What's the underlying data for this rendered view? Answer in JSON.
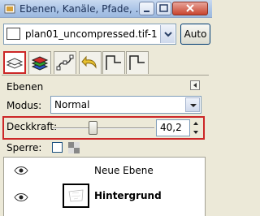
{
  "window": {
    "title": "Ebenen, Kanäle, Pfade, ..."
  },
  "image_selector": {
    "name": "plan01_uncompressed.tif-1",
    "auto_label": "Auto"
  },
  "tabs": [
    "layers",
    "channels",
    "paths",
    "undo-history",
    "tab-5",
    "tab-6"
  ],
  "panel": {
    "title": "Ebenen",
    "mode_label": "Modus:",
    "mode_value": "Normal",
    "opacity_label": "Deckkraft:",
    "opacity_value": "40,2",
    "opacity_fraction": 0.402,
    "lock_label": "Sperre:"
  },
  "layers": [
    {
      "name": "Neue Ebene",
      "visible": true,
      "active": false
    },
    {
      "name": "Hintergrund",
      "visible": true,
      "active": true
    }
  ],
  "colors": {
    "highlight": "#cc2727",
    "title_bar": "#a9c3e6"
  }
}
